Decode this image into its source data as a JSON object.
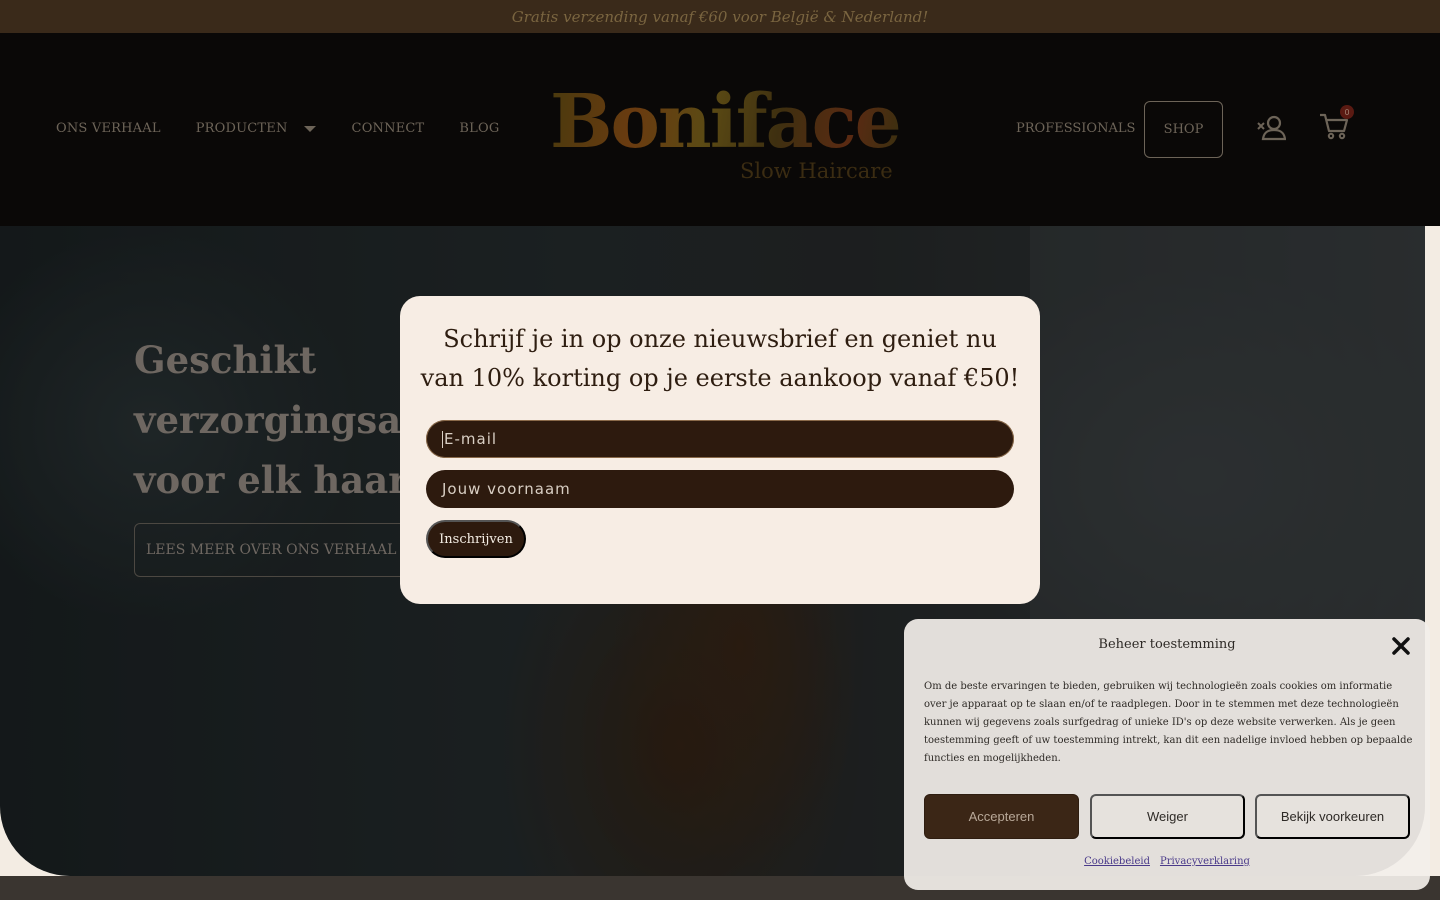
{
  "announcement": {
    "text": "Gratis verzending vanaf €60 voor België & Nederland!"
  },
  "header": {
    "nav_left": [
      {
        "label": "ONS VERHAAL"
      },
      {
        "label": "PRODUCTEN"
      },
      {
        "label": "CONNECT"
      },
      {
        "label": "BLOG"
      }
    ],
    "logo": {
      "main": "Boniface",
      "sub": "Slow Haircare"
    },
    "nav_right": {
      "label": "PROFESSIONALS"
    },
    "shop_label": "SHOP",
    "cart_count": "0",
    "icons": {
      "account": "user-icon",
      "cart": "cart-icon",
      "dropdown": "chevron-down-icon"
    }
  },
  "hero": {
    "title": "Geschikt verzorgingsadvies voor elk haartype",
    "button": "LEES MEER OVER ONS VERHAAL"
  },
  "newsletter": {
    "title": "Schrijf je in op onze nieuwsbrief en geniet nu van 10% korting op je eerste aankoop vanaf €50!",
    "email_placeholder": "E-mail",
    "name_placeholder": "Jouw voornaam",
    "submit": "Inschrijven"
  },
  "cookie": {
    "title": "Beheer toestemming",
    "body": "Om de beste ervaringen te bieden, gebruiken wij technologieën zoals cookies om informatie over je apparaat op te slaan en/of te raadplegen. Door in te stemmen met deze technologieën kunnen wij gegevens zoals surfgedrag of unieke ID's op deze website verwerken. Als je geen toestemming geeft of uw toestemming intrekt, kan dit een nadelige invloed hebben op bepaalde functies en mogelijkheden.",
    "accept": "Accepteren",
    "deny": "Weiger",
    "prefs": "Bekijk voorkeuren",
    "links": [
      "Cookiebeleid",
      "Privacyverklaring"
    ]
  },
  "colors": {
    "topbar": "#3a2a1a",
    "header": "#0a0807",
    "modal_bg": "#f7ede4",
    "input_bg": "#2d1a0e",
    "accept_bg": "#3b2616"
  }
}
